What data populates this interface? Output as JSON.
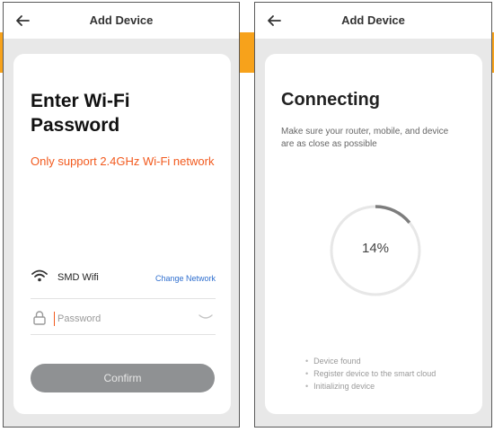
{
  "left_screen": {
    "header": {
      "title": "Add Device"
    },
    "title": "Enter Wi-Fi\nPassword",
    "warning": "Only support 2.4GHz Wi-Fi network",
    "wifi": {
      "name": "SMD Wifi",
      "change_label": "Change Network"
    },
    "password": {
      "placeholder": "Password",
      "value": ""
    },
    "confirm_label": "Confirm"
  },
  "right_screen": {
    "header": {
      "title": "Add Device"
    },
    "title": "Connecting",
    "subtitle": "Make sure your router, mobile, and device are as close as possible",
    "progress": {
      "percent": 14,
      "label": "14%"
    },
    "steps": [
      "Device found",
      "Register device to the smart cloud",
      "Initializing device"
    ]
  },
  "colors": {
    "accent_orange": "#f7a21b",
    "warning_text": "#f25a1e",
    "link_blue": "#2f6fcf",
    "button_gray": "#8f9193"
  },
  "icons": [
    "back-arrow-icon",
    "wifi-icon",
    "lock-icon",
    "eye-hidden-icon"
  ]
}
